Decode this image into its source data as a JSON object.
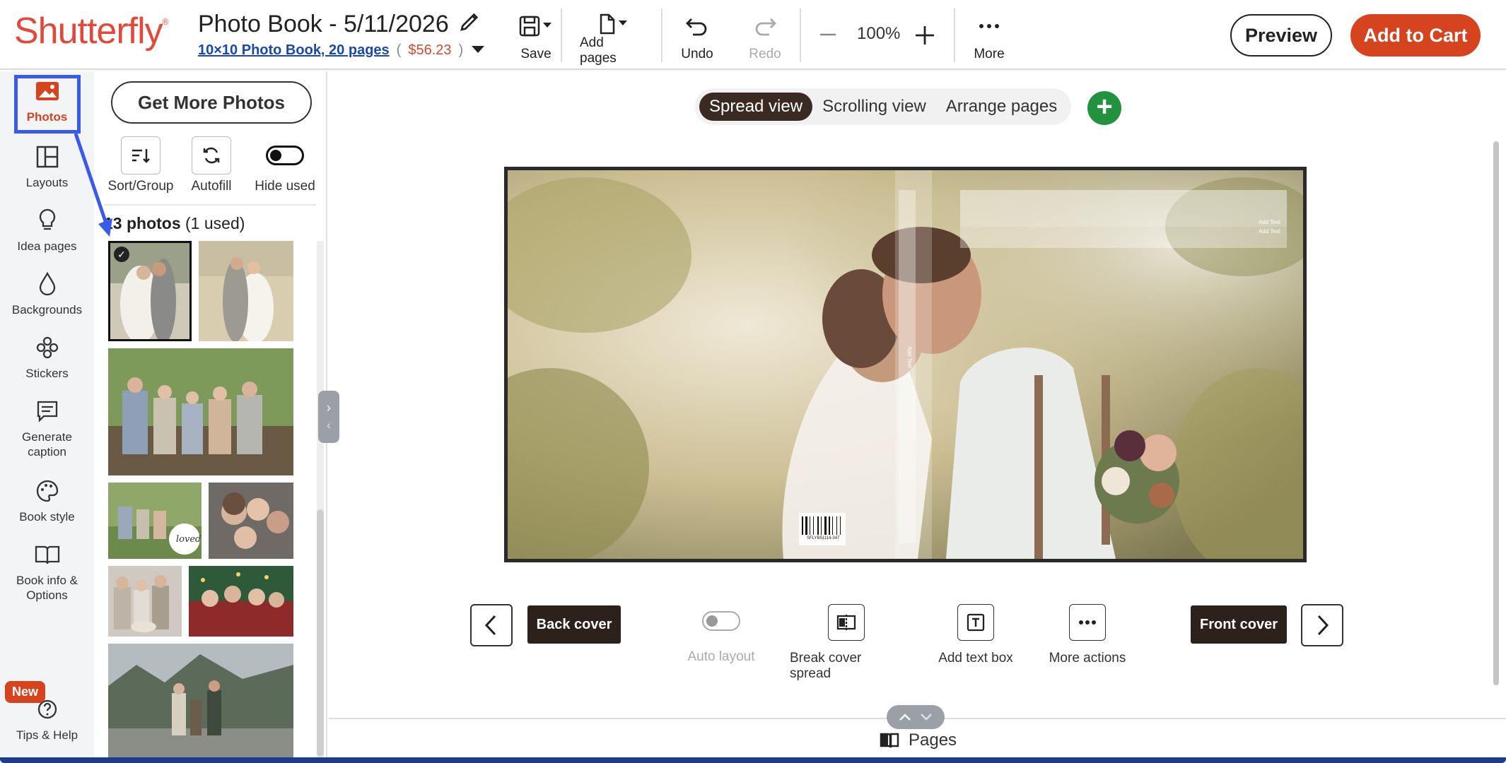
{
  "header": {
    "logo": "Shutterfly",
    "title": "Photo Book - 5/11/2026",
    "product": "10×10 Photo Book, 20 pages",
    "price_open": "(",
    "price": "$56.23",
    "price_close": ")",
    "save": "Save",
    "add_pages": "Add pages",
    "undo": "Undo",
    "redo": "Redo",
    "zoom": "100%",
    "more": "More",
    "preview": "Preview",
    "add_to_cart": "Add to Cart"
  },
  "rail": {
    "photos": "Photos",
    "layouts": "Layouts",
    "idea_pages": "Idea pages",
    "backgrounds": "Backgrounds",
    "stickers": "Stickers",
    "generate_caption": "Generate caption",
    "book_style": "Book style",
    "book_info": "Book info & Options",
    "new_badge": "New",
    "tips": "Tips & Help"
  },
  "panel": {
    "get_more_photos": "Get More Photos",
    "sort_group": "Sort/Group",
    "autofill": "Autofill",
    "hide_used": "Hide used",
    "count_bold": "13 photos",
    "count_rest": "(1 used)"
  },
  "canvas": {
    "views": [
      "Spread view",
      "Scrolling view",
      "Arrange pages"
    ],
    "add_text_1": "Add Text",
    "add_text_2": "Add Text",
    "spine_text": "Add Text",
    "barcode_text": "SFLYB51114-347",
    "back_cover": "Back cover",
    "front_cover": "Front cover",
    "auto_layout": "Auto layout",
    "break_cover_spread": "Break cover spread",
    "add_text_box": "Add text box",
    "more_actions": "More actions"
  },
  "pages_drawer": {
    "label": "Pages"
  },
  "colors": {
    "brand": "#e2493a",
    "cart": "#d6441f",
    "selected_outline": "#3a5bea",
    "add_green": "#22923f"
  }
}
